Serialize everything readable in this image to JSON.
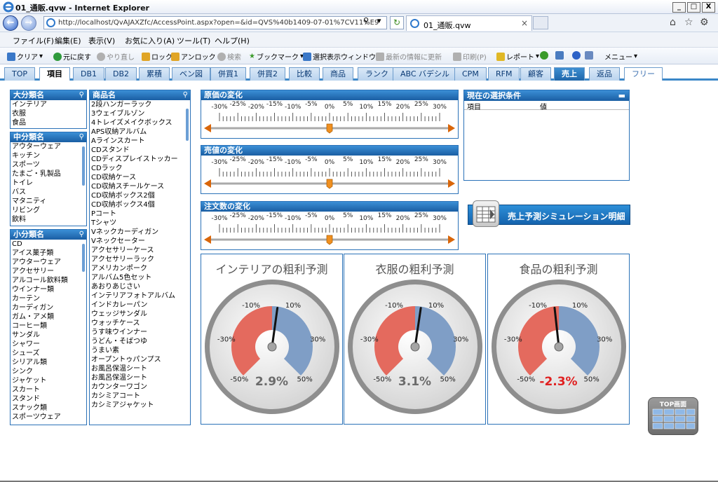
{
  "window": {
    "title": "01_通販.qvw - Internet Explorer",
    "controls": [
      "_",
      "□",
      "X"
    ]
  },
  "address": {
    "url": "http://localhost/QvAJAXZfc/AccessPoint.aspx?open=&id=QVS%40b1409-07-01%7CV11%E9",
    "search_symbol": "⚲",
    "dropdown_symbol": "▾",
    "refresh_symbol": "↻",
    "tab_label": "01_通販.qvw",
    "tab_close": "×"
  },
  "menu": [
    "ファイル(F)",
    "編集(E)",
    "表示(V)",
    "お気に入り(A)",
    "ツール(T)",
    "ヘルプ(H)"
  ],
  "toolbar": {
    "clear": "クリア",
    "back": "元に戻す",
    "redo": "やり直し",
    "lock": "ロック",
    "unlock": "アンロック",
    "search": "検索",
    "bookmark": "ブックマーク",
    "selection_window": "選択表示ウィンドウ",
    "refresh_data": "最新の情報に更新",
    "print": "印刷(P)",
    "report": "レポート",
    "menu": "メニュー"
  },
  "sheet_tabs": [
    "TOP",
    "項目",
    "DB1",
    "DB2",
    "累積",
    "ベン図",
    "併買1",
    "併買2",
    "比較",
    "商品",
    "ランク",
    "ABC バデシル",
    "CPM",
    "RFM",
    "顧客",
    "売上",
    "返品",
    "フリー"
  ],
  "active_tab": "項目",
  "listboxes": {
    "major": {
      "title": "大分類名",
      "items": [
        "インテリア",
        "衣服",
        "食品"
      ]
    },
    "middle": {
      "title": "中分類名",
      "items": [
        "アウターウェア",
        "キッチン",
        "スポーツ",
        "たまご・乳製品",
        "トイレ",
        "バス",
        "マタニティ",
        "リビング",
        "飲料"
      ]
    },
    "minor": {
      "title": "小分類名",
      "items": [
        "CD",
        "アイス菓子類",
        "アウターウェア",
        "アクセサリー",
        "アルコール飲料類",
        "ウインナー類",
        "カーテン",
        "カーディガン",
        "ガム・アメ類",
        "コーヒー類",
        "サンダル",
        "シャワー",
        "シューズ",
        "シリアル類",
        "シンク",
        "ジャケット",
        "スカート",
        "スタンド",
        "スナック類",
        "スポーツウェア"
      ]
    },
    "product": {
      "title": "商品名",
      "items": [
        "2段ハンガーラック",
        "3ウェイブルゾン",
        "4トレイズメイクボックス",
        "APS収納アルバム",
        "Aラインスカート",
        "CDスタンド",
        "CDディスプレイストッカー",
        "CDラック",
        "CD収納ケース",
        "CD収納スチールケース",
        "CD収納ボックス2個",
        "CD収納ボックス4個",
        "Pコート",
        "Tシャツ",
        "Vネックカーディガン",
        "Vネックセーター",
        "アクセサリーケース",
        "アクセサリーラック",
        "アメリカンポーク",
        "アルバム5色セット",
        "あおりあじさい",
        "インテリアフォトアルバム",
        "インドカレーパン",
        "ウェッジサンダル",
        "ウォッチケース",
        "うす味ウインナー",
        "うどん・そばつゆ",
        "うまい素",
        "オープントゥパンプス",
        "お風呂保温シート",
        "お風呂保温シート",
        "カウンターワゴン",
        "カシミアコート",
        "カシミアジャケット"
      ]
    }
  },
  "sliders": {
    "ticks": [
      "-30%",
      "-25%",
      "-20%",
      "-15%",
      "-10%",
      "-5%",
      "0%",
      "5%",
      "10%",
      "15%",
      "20%",
      "25%",
      "30%"
    ],
    "cost": {
      "title": "原価の変化",
      "value_pct": 0
    },
    "price": {
      "title": "売値の変化",
      "value_pct": 0
    },
    "orders": {
      "title": "注文数の変化",
      "value_pct": 0
    }
  },
  "selection": {
    "title": "現在の選択条件",
    "min_symbol": "▬",
    "col_item": "項目",
    "col_value": "値"
  },
  "simulation_button": "売上予測シミュレーション明細",
  "gauges": [
    {
      "title": "インテリアの粗利予測",
      "value_text": "2.9%",
      "value": 2.9
    },
    {
      "title": "衣服の粗利予測",
      "value_text": "3.1%",
      "value": 3.1
    },
    {
      "title": "食品の粗利予測",
      "value_text": "-2.3%",
      "value": -2.3
    }
  ],
  "gauge_labels": [
    "-50%",
    "-30%",
    "-10%",
    "10%",
    "30%",
    "50%"
  ],
  "top_button": "TOP画面",
  "colors": {
    "accent": "#2b72b8",
    "gauge_red": "#e46a5e",
    "gauge_blue": "#7f9ec6",
    "negative": "#e02020",
    "slider_handle": "#f09020"
  }
}
